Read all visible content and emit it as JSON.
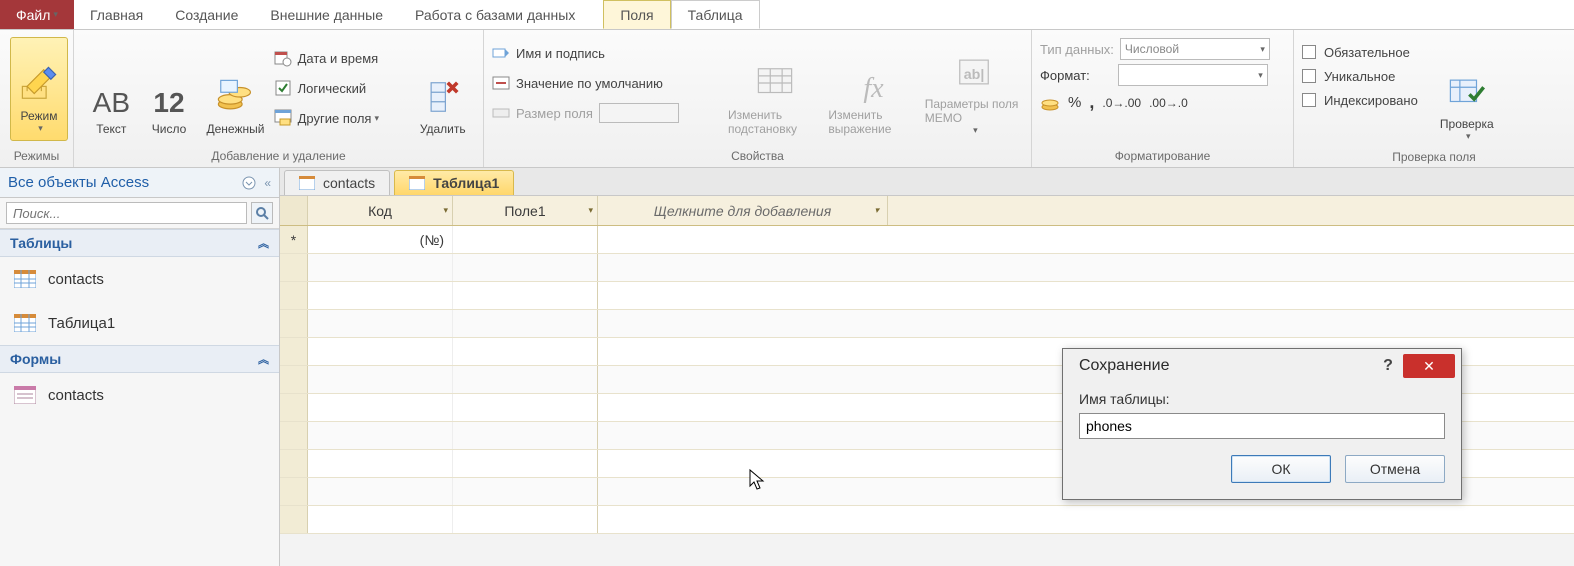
{
  "menu": {
    "file": "Файл",
    "items": [
      "Главная",
      "Создание",
      "Внешние данные",
      "Работа с базами данных"
    ],
    "context_active": "Поля",
    "context_secondary": "Таблица"
  },
  "ribbon": {
    "modes": {
      "btn": "Режим",
      "group": "Режимы"
    },
    "add_delete": {
      "text": "Текст",
      "number": "Число",
      "currency": "Денежный",
      "number_glyph": "12",
      "datetime": "Дата и время",
      "logical": "Логический",
      "other_fields": "Другие поля",
      "delete": "Удалить",
      "group": "Добавление и удаление"
    },
    "properties": {
      "name_caption": "Имя и подпись",
      "default_value": "Значение по умолчанию",
      "field_size": "Размер поля",
      "modify_lookup": "Изменить подстановку",
      "modify_expression": "Изменить выражение",
      "memo_params": "Параметры поля MEMO",
      "group": "Свойства"
    },
    "formatting": {
      "data_type_label": "Тип данных:",
      "data_type_value": "Числовой",
      "format_label": "Формат:",
      "format_value": "",
      "percent": "%",
      "thousand": ",",
      "currency_btn": "₽",
      "inc_dec1": ".0←",
      "inc_dec2": "→.0",
      "group": "Форматирование"
    },
    "validation": {
      "required": "Обязательное",
      "unique": "Уникальное",
      "indexed": "Индексировано",
      "check": "Проверка",
      "group": "Проверка поля"
    }
  },
  "nav": {
    "title": "Все объекты Access",
    "search_placeholder": "Поиск...",
    "sections": {
      "tables": "Таблицы",
      "forms": "Формы"
    },
    "tables": [
      "contacts",
      "Таблица1"
    ],
    "forms": [
      "contacts"
    ]
  },
  "doc_tabs": {
    "tab1": "contacts",
    "tab2": "Таблица1"
  },
  "grid": {
    "columns": {
      "id": "Код",
      "field1": "Поле1",
      "add": "Щелкните для добавления"
    },
    "new_row_id": "(№)",
    "new_row_marker": "*"
  },
  "dialog": {
    "title": "Сохранение",
    "label": "Имя таблицы:",
    "value": "phones",
    "ok": "ОК",
    "cancel": "Отмена"
  }
}
